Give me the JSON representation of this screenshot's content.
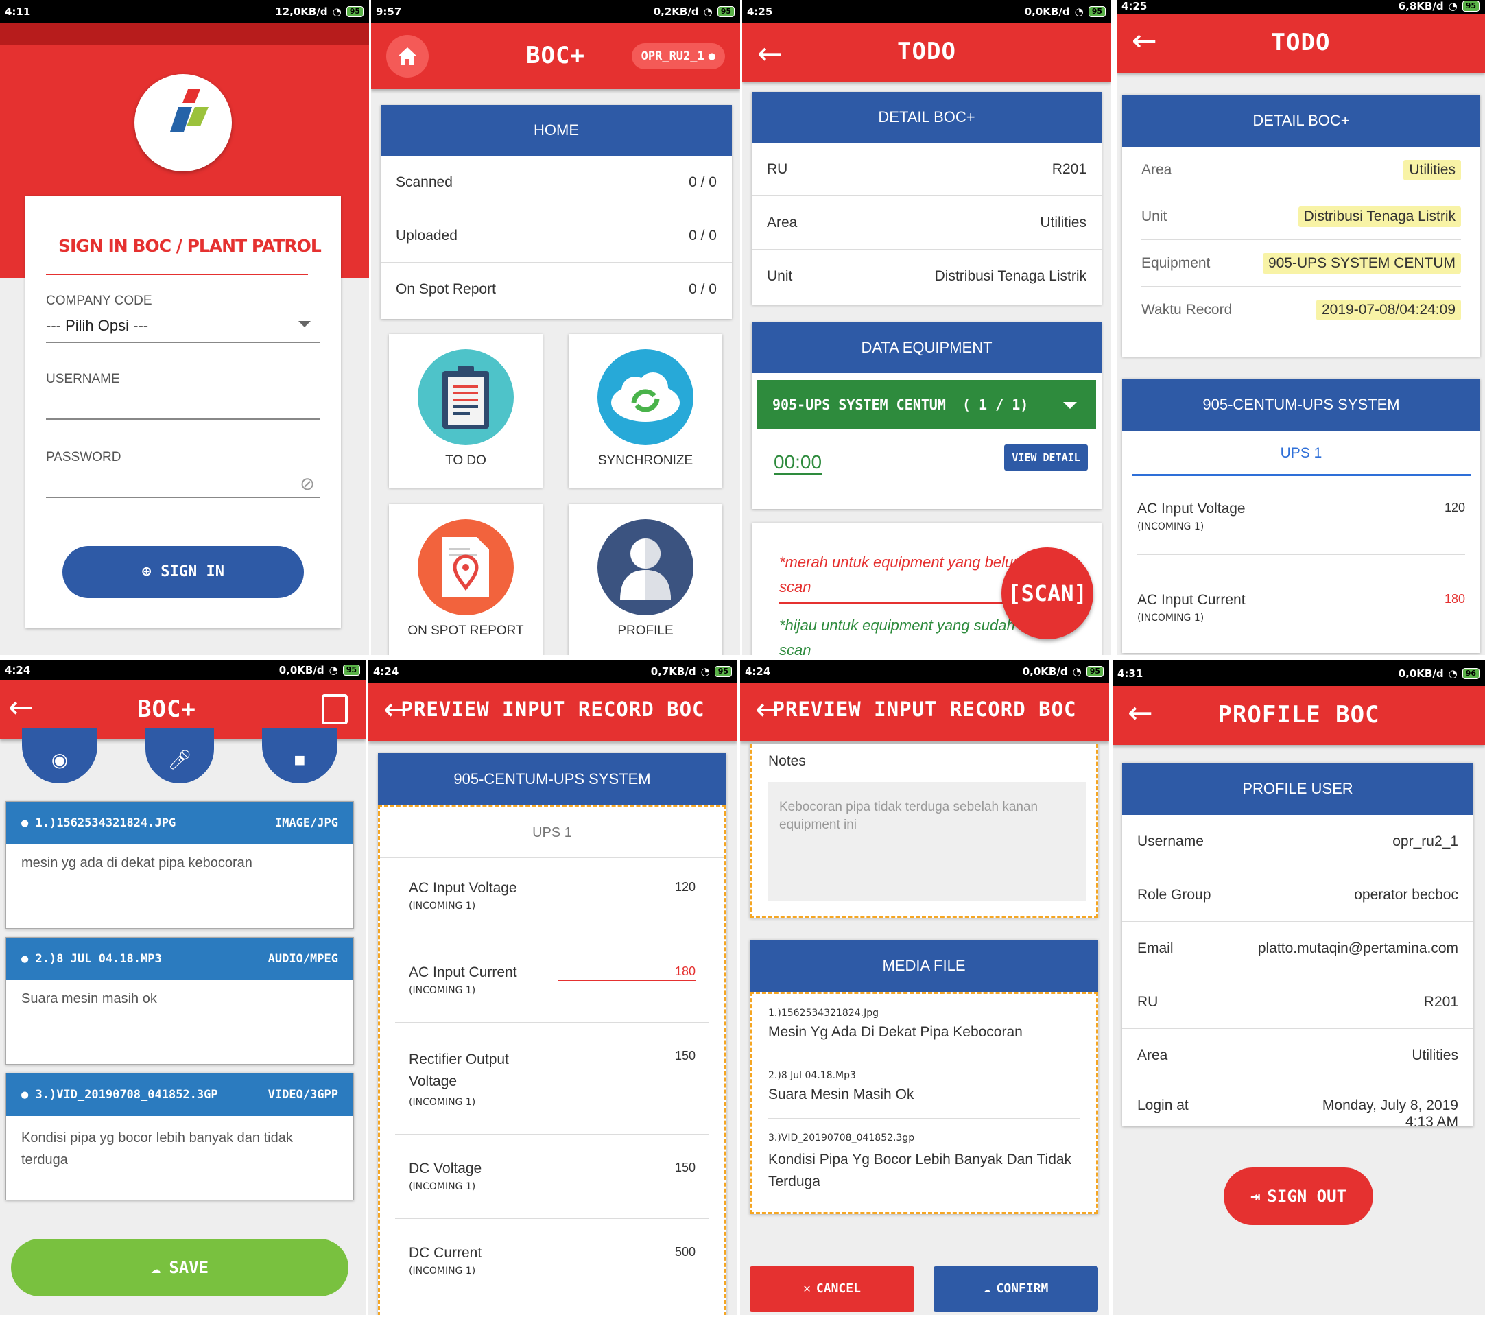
{
  "panels": {
    "login": {
      "time": "4:11",
      "net": "12,0KB/d",
      "battery": "95",
      "title": "SIGN IN BOC / PLANT PATROL",
      "company_label": "COMPANY CODE",
      "company_value": "--- Pilih Opsi ---",
      "username_label": "USERNAME",
      "password_label": "PASSWORD",
      "signin": "SIGN IN"
    },
    "home": {
      "time": "9:57",
      "net": "0,2KB/d",
      "battery": "95",
      "title": "BOC+",
      "user": "OPR_RU2_1",
      "card_title": "HOME",
      "rows": [
        {
          "label": "Scanned",
          "value": "0 / 0"
        },
        {
          "label": "Uploaded",
          "value": "0 / 0"
        },
        {
          "label": "On Spot Report",
          "value": "0 / 0"
        }
      ],
      "tiles": [
        "TO DO",
        "SYNCHRONIZE",
        "ON SPOT REPORT",
        "PROFILE"
      ]
    },
    "todo": {
      "time": "4:25",
      "net": "0,0KB/d",
      "battery": "95",
      "title": "TODO",
      "detail_title": "DETAIL BOC+",
      "rows": [
        {
          "label": "RU",
          "value": "R201"
        },
        {
          "label": "Area",
          "value": "Utilities"
        },
        {
          "label": "Unit",
          "value": "Distribusi Tenaga Listrik"
        }
      ],
      "data_title": "DATA EQUIPMENT",
      "equipment": "905-UPS SYSTEM CENTUM",
      "count": "( 1 / 1)",
      "timer": "00:00",
      "view_detail": "VIEW DETAIL",
      "note_red": "*merah untuk equipment yang belum scan",
      "note_green": "*hijau untuk equipment yang sudah scan",
      "scan": "[SCAN]"
    },
    "todo2": {
      "time": "4:25",
      "net": "6,8KB/d",
      "battery": "95",
      "title": "TODO",
      "detail_title": "DETAIL BOC+",
      "rows": [
        {
          "label": "Area",
          "value": "Utilities"
        },
        {
          "label": "Unit",
          "value": "Distribusi Tenaga Listrik"
        },
        {
          "label": "Equipment",
          "value": "905-UPS SYSTEM CENTUM"
        },
        {
          "label": "Waktu Record",
          "value": "2019-07-08/04:24:09"
        }
      ],
      "sys_title": "905-CENTUM-UPS SYSTEM",
      "tab": "UPS 1",
      "items": [
        {
          "label": "AC Input Voltage",
          "sub": "(INCOMING 1)",
          "value": "120"
        },
        {
          "label": "AC Input Current",
          "sub": "(INCOMING 1)",
          "value": "180"
        }
      ]
    },
    "media": {
      "time": "4:24",
      "net": "0,0KB/d",
      "battery": "95",
      "title": "BOC+",
      "files": [
        {
          "name": "1.)1562534321824.JPG",
          "type": "IMAGE/JPG",
          "note": "mesin yg ada di dekat pipa kebocoran"
        },
        {
          "name": "2.)8 JUL 04.18.MP3",
          "type": "AUDIO/MPEG",
          "note": "Suara mesin masih ok"
        },
        {
          "name": "3.)VID_20190708_041852.3GP",
          "type": "VIDEO/3GPP",
          "note": "Kondisi pipa yg bocor lebih banyak dan tidak terduga"
        }
      ],
      "save": "SAVE"
    },
    "preview1": {
      "time": "4:24",
      "net": "0,7KB/d",
      "battery": "95",
      "title": "PREVIEW INPUT RECORD BOC",
      "sys_title": "905-CENTUM-UPS SYSTEM",
      "tab": "UPS 1",
      "items": [
        {
          "label": "AC Input Voltage",
          "sub": "(INCOMING 1)",
          "value": "120"
        },
        {
          "label": "AC Input Current",
          "sub": "(INCOMING 1)",
          "value": "180"
        },
        {
          "label": "Rectifier Output Voltage",
          "sub": "(INCOMING 1)",
          "value": "150"
        },
        {
          "label": "DC Voltage",
          "sub": "(INCOMING 1)",
          "value": "150"
        },
        {
          "label": "DC Current",
          "sub": "(INCOMING 1)",
          "value": "500"
        }
      ]
    },
    "preview2": {
      "time": "4:24",
      "net": "0,0KB/d",
      "battery": "95",
      "title": "PREVIEW INPUT RECORD BOC",
      "notes_label": "Notes",
      "notes_value": "Kebocoran pipa tidak terduga sebelah kanan equipment ini",
      "media_title": "MEDIA FILE",
      "files": [
        {
          "name": "1.)1562534321824.Jpg",
          "desc": "Mesin Yg Ada Di Dekat Pipa Kebocoran"
        },
        {
          "name": "2.)8 Jul 04.18.Mp3",
          "desc": "Suara Mesin Masih Ok"
        },
        {
          "name": "3.)VID_20190708_041852.3gp",
          "desc": "Kondisi Pipa Yg Bocor Lebih Banyak Dan Tidak Terduga"
        }
      ],
      "cancel": "CANCEL",
      "confirm": "CONFIRM"
    },
    "profile": {
      "time": "4:31",
      "net": "0,0KB/d",
      "battery": "96",
      "title": "PROFILE BOC",
      "card_title": "PROFILE USER",
      "rows": [
        {
          "label": "Username",
          "value": "opr_ru2_1"
        },
        {
          "label": "Role Group",
          "value": "operator becboc"
        },
        {
          "label": "Email",
          "value": "platto.mutaqin@pertamina.com"
        },
        {
          "label": "RU",
          "value": "R201"
        },
        {
          "label": "Area",
          "value": "Utilities"
        },
        {
          "label": "Login at",
          "value": "Monday, July 8, 2019\n4:13 AM"
        }
      ],
      "signout": "SIGN OUT"
    }
  },
  "colors": {
    "primary_red": "#e53130",
    "header_blue": "#2e5aa6",
    "green": "#2e8b3d",
    "save_green": "#79c13f"
  }
}
